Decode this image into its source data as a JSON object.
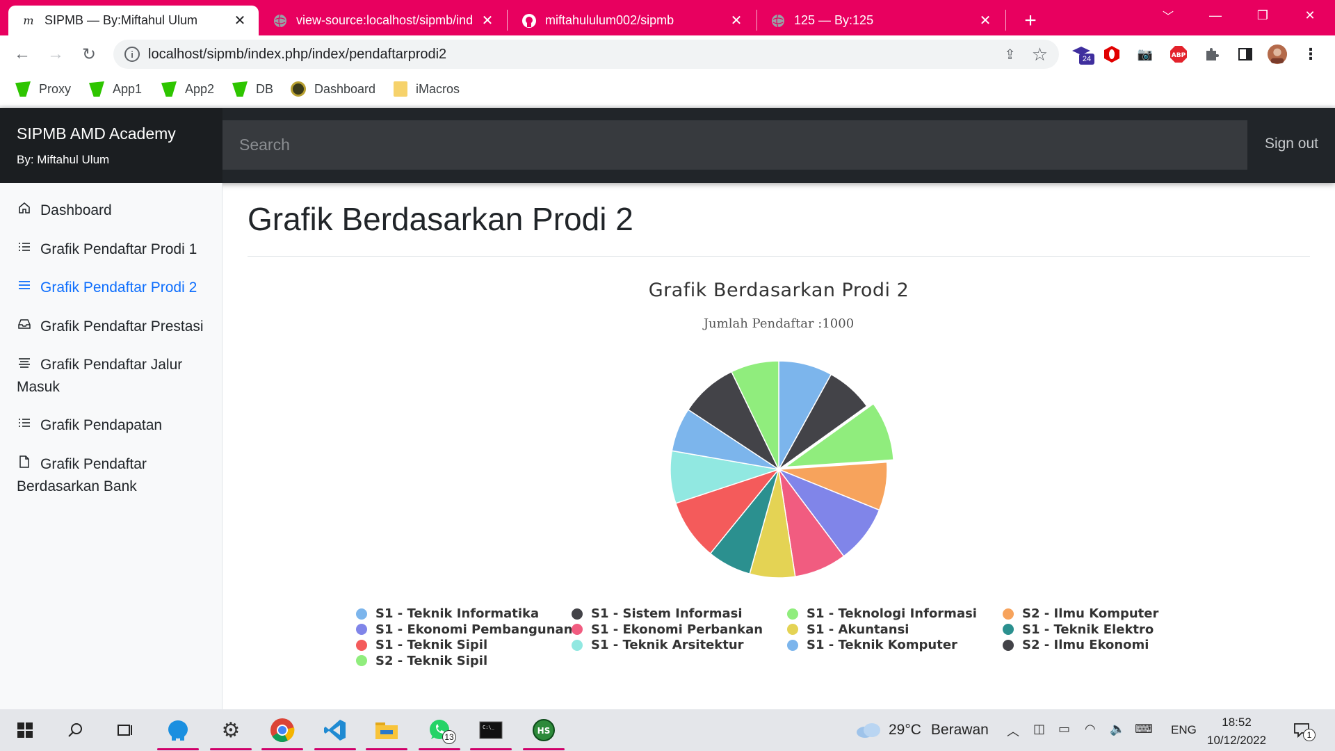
{
  "browser": {
    "tabs": [
      {
        "title": "SIPMB — By:Miftahul Ulum",
        "favicon": "m-script-icon",
        "active": true
      },
      {
        "title": "view-source:localhost/sipmb/ind",
        "favicon": "globe-icon",
        "active": false
      },
      {
        "title": "miftahululum002/sipmb",
        "favicon": "github-icon",
        "active": false
      },
      {
        "title": "125 — By:125",
        "favicon": "globe-icon",
        "active": false
      }
    ],
    "url": "localhost/sipmb/index.php/index/pendaftarprodi2",
    "extension_badge": "24",
    "bookmarks": [
      {
        "label": "Proxy",
        "icon": "green-shield-icon"
      },
      {
        "label": "App1",
        "icon": "green-shield-icon"
      },
      {
        "label": "App2",
        "icon": "green-shield-icon"
      },
      {
        "label": "DB",
        "icon": "green-shield-icon"
      },
      {
        "label": "Dashboard",
        "icon": "emblem-icon"
      },
      {
        "label": "iMacros",
        "icon": "folder-icon"
      }
    ]
  },
  "navbar": {
    "brand": "SIPMB AMD Academy",
    "brand_sub": "By: Miftahul Ulum",
    "search_placeholder": "Search",
    "signout": "Sign out"
  },
  "sidebar": {
    "items": [
      {
        "label": "Dashboard",
        "icon": "home-icon",
        "active": false
      },
      {
        "label": "Grafik Pendaftar Prodi 1",
        "icon": "list-icon",
        "active": false
      },
      {
        "label": "Grafik Pendaftar Prodi 2",
        "icon": "menu-icon",
        "active": true
      },
      {
        "label": "Grafik Pendaftar Prestasi",
        "icon": "inbox-icon",
        "active": false
      },
      {
        "label": "Grafik Pendaftar Jalur Masuk",
        "icon": "align-left-icon",
        "active": false
      },
      {
        "label": "Grafik Pendapatan",
        "icon": "list-icon",
        "active": false
      },
      {
        "label": "Grafik Pendaftar Berdasarkan Bank",
        "icon": "file-icon",
        "active": false
      }
    ]
  },
  "main": {
    "title": "Grafik Berdasarkan Prodi 2"
  },
  "chart_data": {
    "type": "pie",
    "title": "Grafik Berdasarkan Prodi 2",
    "subtitle": "Jumlah Pendaftar :1000",
    "legend_position": "bottom",
    "categories": [
      "S1 - Teknik Informatika",
      "S1 - Sistem Informasi",
      "S1 - Teknologi Informasi",
      "S2 - Ilmu Komputer",
      "S1 - Ekonomi Pembangunan",
      "S1 - Ekonomi Perbankan",
      "S1 - Akuntansi",
      "S1 - Teknik Elektro",
      "S1 - Teknik Sipil",
      "S1 - Teknik Arsitektur",
      "S1 - Teknik Komputer",
      "S2 - Ilmu Ekonomi",
      "S2 - Teknik Sipil"
    ],
    "values": [
      76,
      67,
      84,
      68,
      82,
      74,
      64,
      62,
      86,
      74,
      62,
      81,
      68
    ],
    "colors": [
      "#7cb5ec",
      "#434348",
      "#90ed7d",
      "#f7a35c",
      "#8085e9",
      "#f15c80",
      "#e4d354",
      "#2b908f",
      "#f45b5b",
      "#91e8e1",
      "#7cb5ec",
      "#434348",
      "#90ed7d"
    ],
    "sliced_index": 2
  },
  "taskbar": {
    "apps": [
      "windows-start-icon",
      "search-icon",
      "task-view-icon",
      "elephant-app-icon",
      "settings-icon",
      "chrome-icon",
      "vscode-icon",
      "file-explorer-icon",
      "whatsapp-icon",
      "terminal-icon",
      "hs-app-icon"
    ],
    "whatsapp_badge": "13",
    "weather_temp": "29°C",
    "weather_text": "Berawan",
    "language": "ENG",
    "time": "18:52",
    "date": "10/12/2022",
    "notification_count": "1"
  }
}
